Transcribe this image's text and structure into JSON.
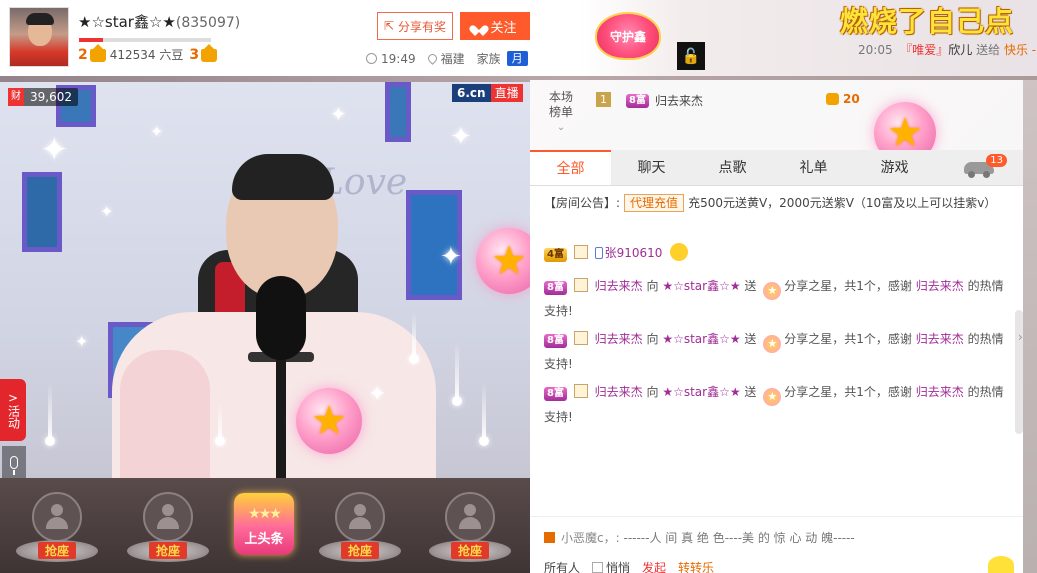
{
  "host": {
    "name": "★☆star鑫☆★",
    "id": "(835097)",
    "level_progress": 0.18,
    "level_left": "2",
    "six_beans": "412534 六豆",
    "level_right": "3"
  },
  "actions": {
    "share_label": "分享有奖",
    "follow_label": "关注"
  },
  "info": {
    "time": "19:49",
    "location": "福建",
    "family_label": "家族",
    "family_badge": "月"
  },
  "guard_label": "守护鑫",
  "banner_text": "燃烧了自己点",
  "ticker": {
    "time": "20:05",
    "tag": "『唯爱』",
    "user": "欣儿",
    "verb": "送给",
    "target": "快乐 -"
  },
  "video": {
    "wealth_tag": "财",
    "wealth_value": "39,602",
    "logo_a": "6.cn",
    "logo_b": "直播",
    "love_text": "Love",
    "activity_label": "活动",
    "activity_arrow": ">"
  },
  "seats": {
    "seat_label": "抢座",
    "headline_label": "上头条",
    "headline_stars": "★★★"
  },
  "ranking": {
    "label_line1": "本场",
    "label_line2": "榜单",
    "rank": "1",
    "badge": "8富",
    "user": "归去来杰",
    "coins": "20"
  },
  "tabs": [
    {
      "label": "全部"
    },
    {
      "label": "聊天"
    },
    {
      "label": "点歌"
    },
    {
      "label": "礼单"
    },
    {
      "label": "游戏"
    }
  ],
  "tab_badge": "13",
  "notice": {
    "prefix": "【房间公告】:",
    "tag": "代理充值",
    "text": "充500元送黄V，2000元送紫V（10富及以上可以挂紫v）"
  },
  "messages": {
    "m0": {
      "badge": "4富",
      "user": "张910610"
    },
    "gift": {
      "badge": "8富",
      "user": "归去来杰",
      "to": "向",
      "target": "★☆star鑫☆★",
      "send": "送",
      "gift_name": "分享之星，共1个，感谢",
      "thanks_user": "归去来杰",
      "tail": "的热情",
      "support": "支持!"
    }
  },
  "whisper": {
    "name": "小恶魔c，:",
    "text": "------人 间 真 绝 色----美 的 惊 心 动 魄-----"
  },
  "controls": {
    "audience": "所有人",
    "quiet": "悄悄",
    "launch": "发起",
    "happy": "转转乐"
  }
}
